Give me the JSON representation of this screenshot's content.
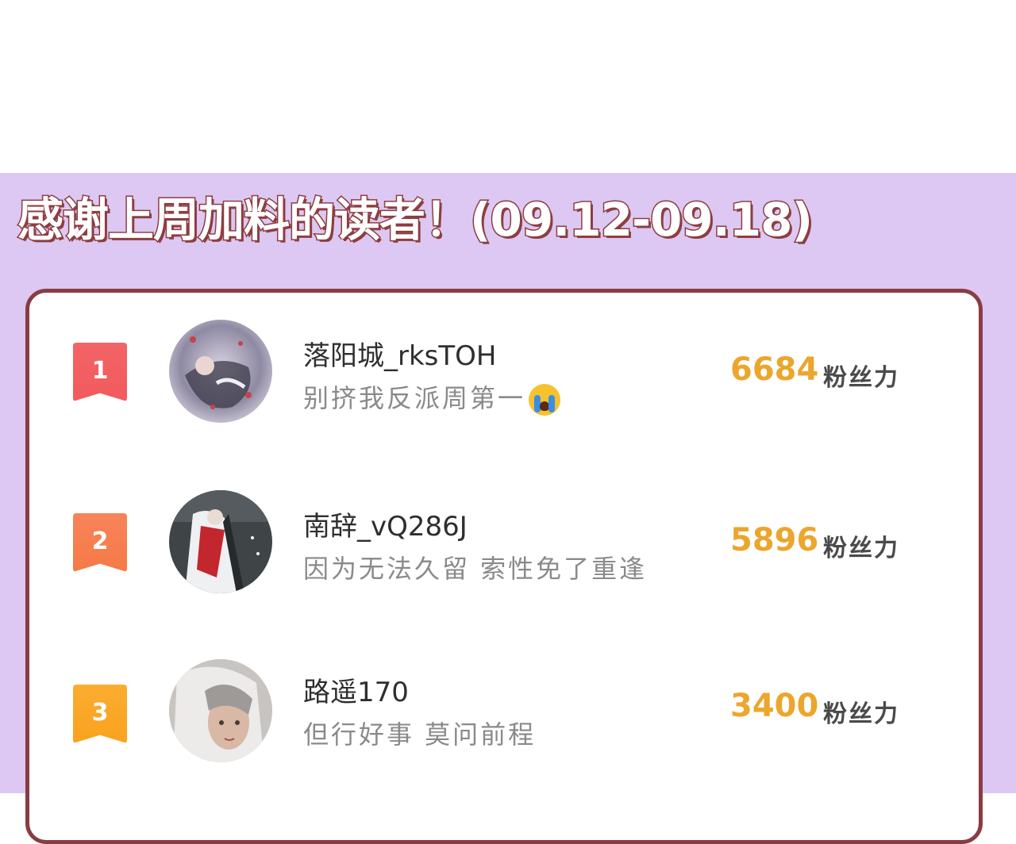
{
  "banner": {
    "title": "感谢上周加料的读者！(09.12-09.18)"
  },
  "colors": {
    "panel_bg": "#dcc8f2",
    "card_border": "#8a3c43",
    "score": "#eba62c",
    "rank1": "#f25a5e",
    "rank2": "#f57a45",
    "rank3": "#f9a21e"
  },
  "ranking": [
    {
      "rank": "1",
      "name": "落阳城_rksTOH",
      "motto": "别挤我反派周第一",
      "emoji": "loudly-crying-face-icon",
      "score": "6684",
      "unit": "粉丝力"
    },
    {
      "rank": "2",
      "name": "南辞_vQ286J",
      "motto": "因为无法久留 索性免了重逢",
      "score": "5896",
      "unit": "粉丝力"
    },
    {
      "rank": "3",
      "name": "路遥170",
      "motto": "但行好事 莫问前程",
      "score": "3400",
      "unit": "粉丝力"
    }
  ]
}
